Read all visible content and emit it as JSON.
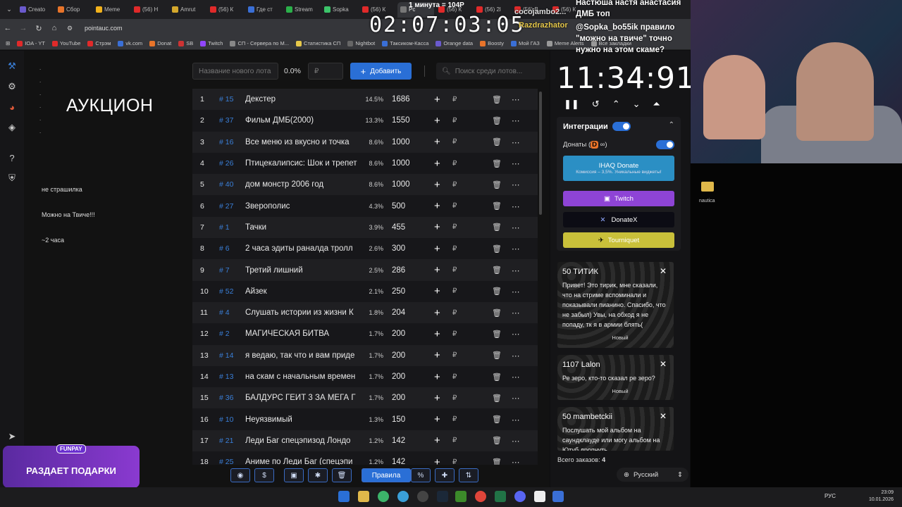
{
  "browser": {
    "tabs": [
      "Creato",
      "Сбор",
      "Meme",
      "(56) Н",
      "Amrut",
      "(56) К",
      "Где ст",
      "Stream",
      "Sopka",
      "(56) К",
      "Рс",
      "(56) К",
      "(56) 2l",
      "(56) В",
      "(56) К"
    ],
    "url": "pointauc.com",
    "bookmarks": [
      "IOA - YT",
      "YouTube",
      "Стрэм",
      "vk.com",
      "Donat",
      "SB",
      "Twitch",
      "СП - Сервера по М...",
      "Статистика СП",
      "Nightbot",
      "Таксиком-Касса",
      "Orange data",
      "Boosty",
      "Мой ГАЗ",
      "Meme Alerts",
      "Все закладки"
    ]
  },
  "overlay": {
    "big_timer": "02:07:03:05",
    "top_text": "1 минута = 104Р",
    "chat": [
      "cocojambo2...",
      "Настюша настя анастасия",
      "ДМБ топ",
      "@Sopka_bo55ik правило",
      "\"можно на твиче\" точно",
      "нужно на этом скаме?"
    ],
    "razd": "Razdrazhator"
  },
  "leftpane": {
    "title": "АУКЦИОН",
    "notes": [
      "не страшилка",
      "Можно на  Твиче!!!",
      "~2 часа"
    ],
    "promo_tag": "FUNPAY",
    "promo": "РАЗДАЕТ ПОДАРКИ"
  },
  "controls": {
    "new_lot_placeholder": "Название нового лота",
    "percent": "0.0%",
    "currency": "₽",
    "add": "Добавить",
    "search_placeholder": "Поиск среди лотов..."
  },
  "lots": [
    {
      "n": "1",
      "id": "# 15",
      "name": "Декстер",
      "pct": "14.5%",
      "amt": "1686"
    },
    {
      "n": "2",
      "id": "# 37",
      "name": "Фильм ДМБ(2000)",
      "pct": "13.3%",
      "amt": "1550"
    },
    {
      "n": "3",
      "id": "# 16",
      "name": "Все меню из вкусно и точка",
      "pct": "8.6%",
      "amt": "1000"
    },
    {
      "n": "4",
      "id": "# 26",
      "name": "Птицекалипсис: Шок и трепет",
      "pct": "8.6%",
      "amt": "1000"
    },
    {
      "n": "5",
      "id": "# 40",
      "name": "дом монстр 2006 год",
      "pct": "8.6%",
      "amt": "1000"
    },
    {
      "n": "6",
      "id": "# 27",
      "name": "Зверополис",
      "pct": "4.3%",
      "amt": "500"
    },
    {
      "n": "7",
      "id": "# 1",
      "name": "Тачки",
      "pct": "3.9%",
      "amt": "455"
    },
    {
      "n": "8",
      "id": "# 6",
      "name": "2 часа эдиты раналда тролл",
      "pct": "2.6%",
      "amt": "300"
    },
    {
      "n": "9",
      "id": "# 7",
      "name": "Третий лишний",
      "pct": "2.5%",
      "amt": "286"
    },
    {
      "n": "10",
      "id": "# 52",
      "name": "Айзек",
      "pct": "2.1%",
      "amt": "250"
    },
    {
      "n": "11",
      "id": "# 4",
      "name": "Слушать истории из жизни К",
      "pct": "1.8%",
      "amt": "204"
    },
    {
      "n": "12",
      "id": "# 2",
      "name": "МАГИЧЕСКАЯ БИТВА",
      "pct": "1.7%",
      "amt": "200"
    },
    {
      "n": "13",
      "id": "# 14",
      "name": "я ведаю, так что и вам приде",
      "pct": "1.7%",
      "amt": "200"
    },
    {
      "n": "14",
      "id": "# 13",
      "name": "на скам с начальным времен",
      "pct": "1.7%",
      "amt": "200"
    },
    {
      "n": "15",
      "id": "# 36",
      "name": "БАЛДУРС ГЕЙТ 3 ЗА МЕГА Г",
      "pct": "1.7%",
      "amt": "200"
    },
    {
      "n": "16",
      "id": "# 10",
      "name": "Неуязвимый",
      "pct": "1.3%",
      "amt": "150"
    },
    {
      "n": "17",
      "id": "# 21",
      "name": "Леди Баг спецэпизод Лондо",
      "pct": "1.2%",
      "amt": "142"
    },
    {
      "n": "18",
      "id": "# 25",
      "name": "Аниме по Леди Баг (спецэпи",
      "pct": "1.2%",
      "amt": "142"
    }
  ],
  "toolbar": {
    "rules": "Правила",
    "percent_icon": "%"
  },
  "rightpanel": {
    "clock": "11:34:91",
    "integrations": "Интеграции",
    "donations": "Донаты (",
    "donate_btn": "IHAQ Donate",
    "donate_sub": "Комиссия – 3,5%. Уникальные виджеты!",
    "twitch": "Twitch",
    "donatex": "DonateX",
    "tourniquet": "Tourniquet",
    "messages": [
      {
        "title": "50 ТИТИК",
        "body": "Привет! Это тирик, мне сказали, что на стриме вспоминали и показывали пианино. Спасибо, что не забыл) Увы, на обход я не попаду, тк я в армии блять(",
        "status": "Новый"
      },
      {
        "title": "1107 Lalon",
        "body": "Ре зеро, кто-то сказал ре зеро?",
        "status": "Новый"
      },
      {
        "title": "50 mambetckii",
        "body": "Послушать мой альбом на саундклауде или могу альбом на Ютуб дропнуть"
      }
    ],
    "orders_label": "Всего заказов:",
    "orders_count": "4",
    "language": "Русский"
  },
  "desktop": {
    "folder": "nautica"
  },
  "tray": {
    "lang": "РУС",
    "time": "23:09",
    "date": "10.01.2026"
  }
}
